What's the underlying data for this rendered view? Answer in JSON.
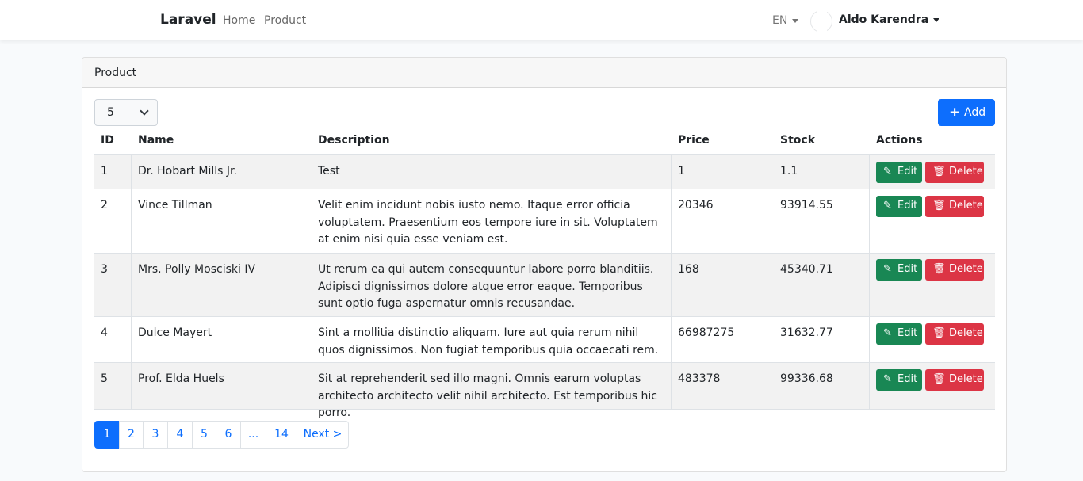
{
  "navbar": {
    "brand": "Laravel",
    "links": [
      "Home",
      "Product"
    ],
    "language": "EN",
    "user_name": "Aldo Karendra"
  },
  "card": {
    "title": "Product",
    "per_page_value": "5",
    "add_label": "Add"
  },
  "table": {
    "headers": [
      "ID",
      "Name",
      "Description",
      "Price",
      "Stock",
      "Actions"
    ],
    "edit_label": "Edit",
    "delete_label": "Delete",
    "rows": [
      {
        "id": "1",
        "name": "Dr. Hobart Mills Jr.",
        "description": "Test",
        "price": "1",
        "stock": "1.1"
      },
      {
        "id": "2",
        "name": "Vince Tillman",
        "description": "Velit enim incidunt nobis iusto nemo. Itaque error officia voluptatem. Praesentium eos tempore iure in sit. Voluptatem at enim nisi quia esse veniam est.",
        "price": "20346",
        "stock": "93914.55"
      },
      {
        "id": "3",
        "name": "Mrs. Polly Mosciski IV",
        "description": "Ut rerum ea qui autem consequuntur labore porro blanditiis. Adipisci dignissimos dolore atque error eaque. Temporibus sunt optio fuga aspernatur omnis recusandae.",
        "price": "168",
        "stock": "45340.71"
      },
      {
        "id": "4",
        "name": "Dulce Mayert",
        "description": "Sint a mollitia distinctio aliquam. Iure aut quia rerum nihil quos dignissimos. Non fugiat temporibus quia occaecati rem.",
        "price": "66987275",
        "stock": "31632.77"
      },
      {
        "id": "5",
        "name": "Prof. Elda Huels",
        "description": "Sit at reprehenderit sed illo magni. Omnis earum voluptas architecto architecto velit nihil architecto. Est temporibus hic porro.",
        "price": "483378",
        "stock": "99336.68"
      }
    ]
  },
  "pagination": {
    "pages": [
      "1",
      "2",
      "3",
      "4",
      "5",
      "6",
      "...",
      "14",
      "Next >"
    ],
    "active": "1"
  },
  "colors": {
    "primary": "#0d6efd",
    "success": "#198754",
    "danger": "#dc3545"
  },
  "icons": {
    "add": "plus-icon",
    "edit": "pencil-icon",
    "delete": "trash-icon",
    "dropdown": "caret-down-icon"
  }
}
